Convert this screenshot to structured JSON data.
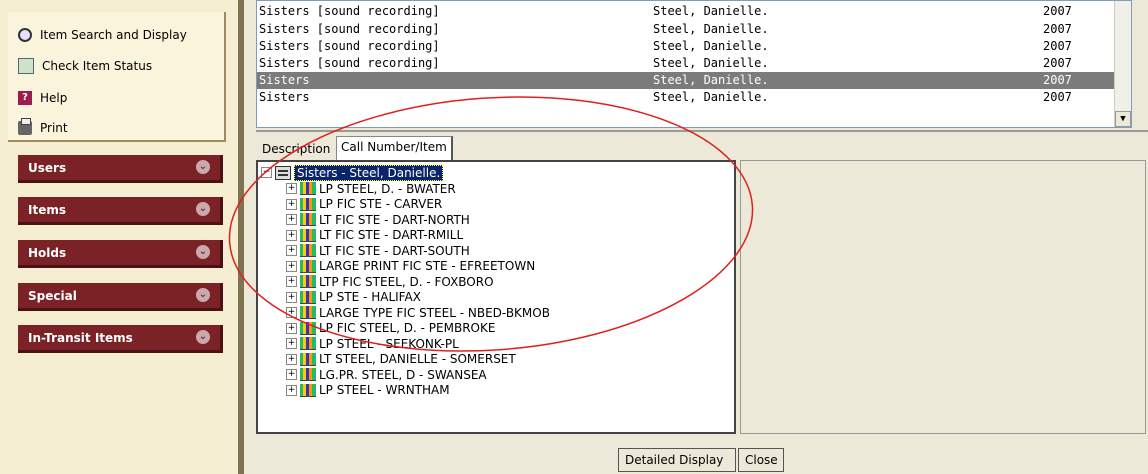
{
  "tasks": [
    {
      "label": "Item Search and Display",
      "icon": "search-icon"
    },
    {
      "label": "Check Item Status",
      "icon": "check-status-icon"
    },
    {
      "label": "Help",
      "icon": "help-icon"
    },
    {
      "label": "Print",
      "icon": "print-icon"
    }
  ],
  "nav": [
    {
      "label": "Users"
    },
    {
      "label": "Items"
    },
    {
      "label": "Holds"
    },
    {
      "label": "Special"
    },
    {
      "label": "In-Transit Items"
    }
  ],
  "results": [
    {
      "title": "Sisters [sound recording]",
      "author": "Steel, Danielle.",
      "year": "2007"
    },
    {
      "title": "Sisters [sound recording]",
      "author": "Steel, Danielle.",
      "year": "2007"
    },
    {
      "title": "Sisters [sound recording]",
      "author": "Steel, Danielle.",
      "year": "2007"
    },
    {
      "title": "Sisters [sound recording]",
      "author": "Steel, Danielle.",
      "year": "2007"
    },
    {
      "title": "Sisters",
      "author": "Steel, Danielle.",
      "year": "2007",
      "selected": true
    },
    {
      "title": "Sisters",
      "author": "Steel, Danielle.",
      "year": "2007"
    }
  ],
  "tabs": {
    "description": "Description",
    "call_number": "Call Number/Item"
  },
  "tree": {
    "root": "Sisters - Steel, Danielle.",
    "items": [
      "LP STEEL, D. - BWATER",
      "LP FIC STE - CARVER",
      "LT FIC STE - DART-NORTH",
      "LT FIC STE - DART-RMILL",
      "LT FIC STE - DART-SOUTH",
      "LARGE PRINT FIC STE - EFREETOWN",
      "LTP FIC STEEL, D. - FOXBORO",
      "LP STE - HALIFAX",
      "LARGE TYPE FIC STEEL - NBED-BKMOB",
      "LP FIC STEEL, D. - PEMBROKE",
      "LP STEEL - SEEKONK-PL",
      "LT STEEL, DANIELLE - SOMERSET",
      "LG.PR. STEEL, D - SWANSEA",
      "LP STEEL - WRNTHAM"
    ]
  },
  "buttons": {
    "detailed_display": "Detailed Display",
    "close": "Close"
  },
  "colors": {
    "nav_bg": "#7a2226",
    "panel_bg": "#f6eed2",
    "selected_row": "#7b7b7b",
    "annotation": "#e0201c"
  }
}
